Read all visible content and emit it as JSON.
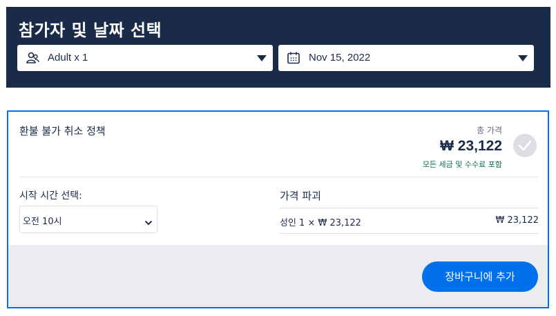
{
  "header": {
    "title": "참가자 및 날짜 선택",
    "participants": {
      "label": "Adult x 1",
      "icon": "participants-icon"
    },
    "date": {
      "label": "Nov 15, 2022",
      "icon": "calendar-icon"
    }
  },
  "option": {
    "policy_title": "환불 불가 취소 정책",
    "total_label": "총 가격",
    "total_price": "₩ 23,122",
    "total_note": "모든 세금 및 수수료 포함",
    "start_time_label": "시작 시간 선택:",
    "start_time_value": "오전 10시",
    "price_breakdown_title": "가격 파괴",
    "breakdown_desc": "성인 1 × ₩ 23,122",
    "breakdown_amount": "₩ 23,122",
    "add_to_cart": "장바구니에 추가"
  },
  "colors": {
    "header_bg": "#1a2b49",
    "accent": "#0071eb",
    "note_green": "#0a6b52"
  }
}
